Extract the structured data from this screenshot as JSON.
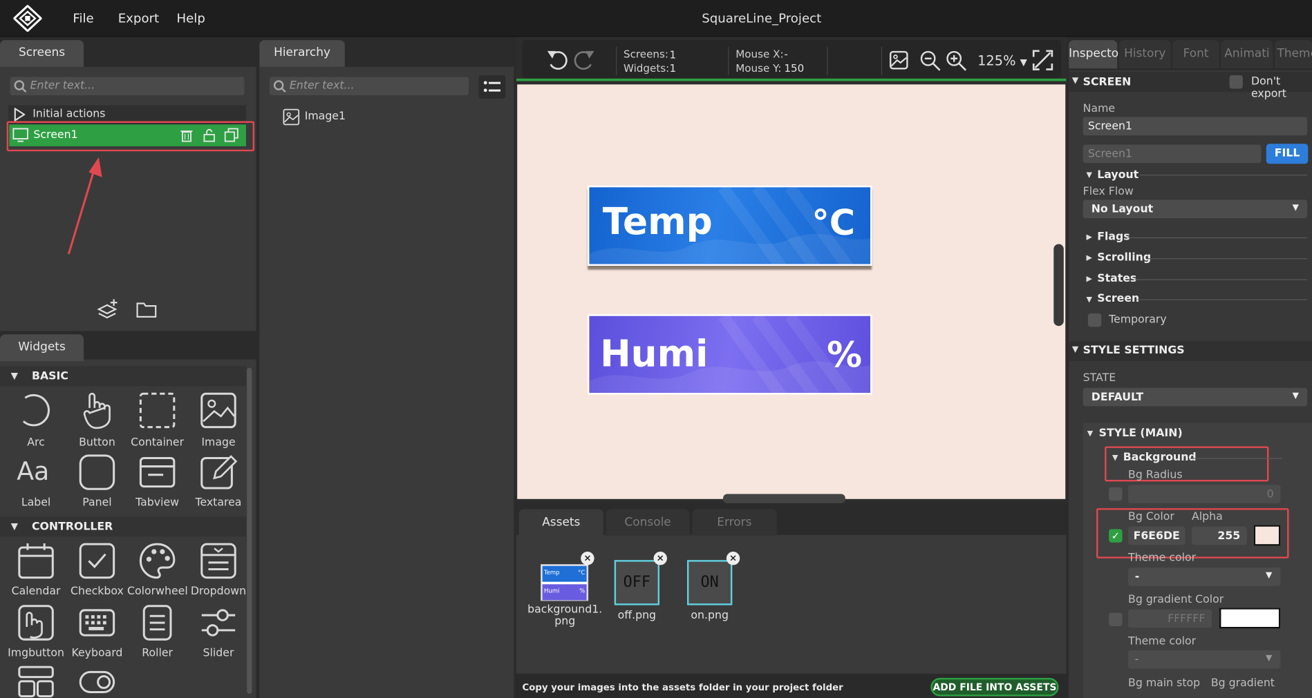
{
  "app": {
    "title": "SquareLine_Project",
    "menu": [
      "File",
      "Export",
      "Help"
    ]
  },
  "screens_panel": {
    "tab": "Screens",
    "search_placeholder": "Enter text...",
    "initial_actions": "Initial actions",
    "selected_screen": "Screen1"
  },
  "hierarchy_panel": {
    "tab": "Hierarchy",
    "search_placeholder": "Enter text...",
    "items": [
      "Image1"
    ]
  },
  "widgets_panel": {
    "tab": "Widgets",
    "sections": [
      {
        "title": "BASIC",
        "items": [
          "Arc",
          "Button",
          "Container",
          "Image",
          "Label",
          "Panel",
          "Tabview",
          "Textarea"
        ]
      },
      {
        "title": "CONTROLLER",
        "items": [
          "Calendar",
          "Checkbox",
          "Colorwheel",
          "Dropdown",
          "Imgbutton",
          "Keyboard",
          "Roller",
          "Slider"
        ]
      }
    ]
  },
  "toolbar": {
    "screens_label": "Screens:",
    "screens_value": "1",
    "widgets_label": "Widgets:",
    "widgets_value": "1",
    "mouse_x_label": "Mouse X:",
    "mouse_x_value": "-",
    "mouse_y_label": "Mouse Y:",
    "mouse_y_value": "150",
    "zoom": "125%"
  },
  "canvas": {
    "bg_color": "#F6E6DE",
    "cards": [
      {
        "label": "Temp",
        "unit": "°C",
        "color": "#1f6fd6"
      },
      {
        "label": "Humi",
        "unit": "%",
        "color": "#6a5ce0"
      }
    ]
  },
  "bottom_panel": {
    "tabs": [
      "Assets",
      "Console",
      "Errors"
    ],
    "assets": [
      {
        "name": "background1.\npng",
        "thumb_top": "Temp",
        "thumb_top_unit": "°C",
        "thumb_bottom": "Humi",
        "thumb_bottom_unit": "%"
      },
      {
        "name": "off.png",
        "thumb_text": "OFF"
      },
      {
        "name": "on.png",
        "thumb_text": "ON"
      }
    ],
    "footer_text": "Copy your images into the assets folder in your project folder",
    "add_button": "ADD FILE INTO ASSETS"
  },
  "inspector": {
    "tabs": [
      "Inspecto",
      "History",
      "Font",
      "Animati",
      "Theme"
    ],
    "screen_header": "SCREEN",
    "dont_export": "Don't export",
    "name_label": "Name",
    "name_value": "Screen1",
    "name_placeholder": "Screen1",
    "fill_button": "FILL",
    "layout_header": "Layout",
    "flex_flow_label": "Flex Flow",
    "flex_flow_value": "No Layout",
    "flags": "Flags",
    "scrolling": "Scrolling",
    "states": "States",
    "screen_sub": "Screen",
    "temporary": "Temporary",
    "style_settings": "STYLE SETTINGS",
    "state_label": "STATE",
    "state_value": "DEFAULT",
    "style_main": "STYLE (MAIN)",
    "background": "Background",
    "bg_radius_label": "Bg Radius",
    "bg_radius_value": "0",
    "bg_color_label": "Bg Color",
    "alpha_label": "Alpha",
    "bg_color_value": "F6E6DE",
    "alpha_value": "255",
    "theme_color_label": "Theme color",
    "theme_color_value": "-",
    "bg_gradient_label": "Bg gradient Color",
    "bg_gradient_value": "FFFFFF",
    "theme_color2_label": "Theme color",
    "theme_color2_value": "-",
    "bg_main_stop": "Bg main stop",
    "bg_gradient2": "Bg gradient"
  },
  "colors": {
    "accent_green": "#2ea043",
    "fill_blue": "#2d7ddb",
    "highlight_red": "#e0484f"
  }
}
